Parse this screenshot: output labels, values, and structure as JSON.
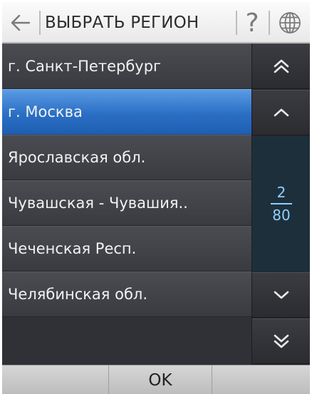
{
  "header": {
    "title": "ВЫБРАТЬ РЕГИОН",
    "help_label": "?"
  },
  "regions": [
    {
      "name": "г. Санкт-Петербург",
      "selected": false
    },
    {
      "name": "г. Москва",
      "selected": true
    },
    {
      "name": "Ярославская обл.",
      "selected": false
    },
    {
      "name": "Чувашская - Чувашия..",
      "selected": false
    },
    {
      "name": "Чеченская Респ.",
      "selected": false
    },
    {
      "name": "Челябинская обл.",
      "selected": false
    }
  ],
  "pagination": {
    "current": "2",
    "total": "80"
  },
  "footer": {
    "ok_label": "OK"
  },
  "icons": {
    "back": "arrow-left-icon",
    "globe": "globe-icon",
    "page_up": "double-chevron-up-icon",
    "line_up": "chevron-up-icon",
    "line_down": "chevron-down-icon",
    "page_down": "double-chevron-down-icon"
  },
  "colors": {
    "selected_row": "#2a6fc5",
    "row_bg": "#414348",
    "page_indicator": "#8fd0ff",
    "header_bg": "#f2f2f2"
  }
}
